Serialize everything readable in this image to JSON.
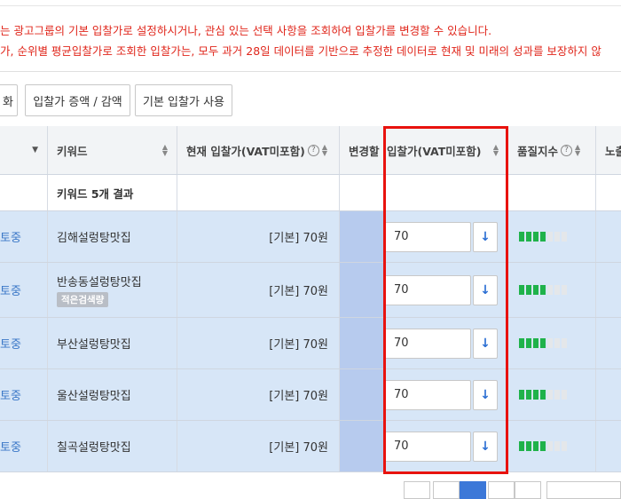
{
  "notice": {
    "line1": "는 광고그룹의 기본 입찰가로 설정하시거나, 관심 있는 선택 사항을 조회하여 입찰가를 변경할 수 있습니다.",
    "line2": "가, 순위별 평균입찰가로 조회한 입찰가는, 모두 과거 28일 데이터를 기반으로 추정한 데이터로 현재 및 미래의 성과를 보장하지 않"
  },
  "toolbar": {
    "btn_partial": "화",
    "btn_increase": "입찰가 증액 / 감액",
    "btn_default": "기본 입찰가 사용"
  },
  "table": {
    "headers": {
      "status": "",
      "keyword": "키워드",
      "current_bid": "현재 입찰가(VAT미포함)",
      "change": "변경할",
      "new_bid": "입찰가(VAT미포함)",
      "quality": "품질지수",
      "exposure": "노출"
    },
    "summary": "키워드 5개 결과",
    "rows": [
      {
        "status": "토중",
        "keyword": "김해설렁탕맛집",
        "tag": "",
        "current_bid": "[기본] 70원",
        "bid": "70",
        "quality": 4
      },
      {
        "status": "토중",
        "keyword": "반송동설렁탕맛집",
        "tag": "적은검색량",
        "current_bid": "[기본] 70원",
        "bid": "70",
        "quality": 4
      },
      {
        "status": "토중",
        "keyword": "부산설렁탕맛집",
        "tag": "",
        "current_bid": "[기본] 70원",
        "bid": "70",
        "quality": 4
      },
      {
        "status": "토중",
        "keyword": "울산설렁탕맛집",
        "tag": "",
        "current_bid": "[기본] 70원",
        "bid": "70",
        "quality": 4
      },
      {
        "status": "토중",
        "keyword": "칠곡설렁탕맛집",
        "tag": "",
        "current_bid": "[기본] 70원",
        "bid": "70",
        "quality": 4
      }
    ]
  },
  "icons": {
    "down_arrow": "↓",
    "question": "?",
    "caret": "▼",
    "sort_up": "▲",
    "sort_down": "▼"
  },
  "colors": {
    "highlight": "#e8120e",
    "row_bg": "#d7e6f7",
    "quality_on": "#1fb24a",
    "link": "#3a77c7"
  }
}
